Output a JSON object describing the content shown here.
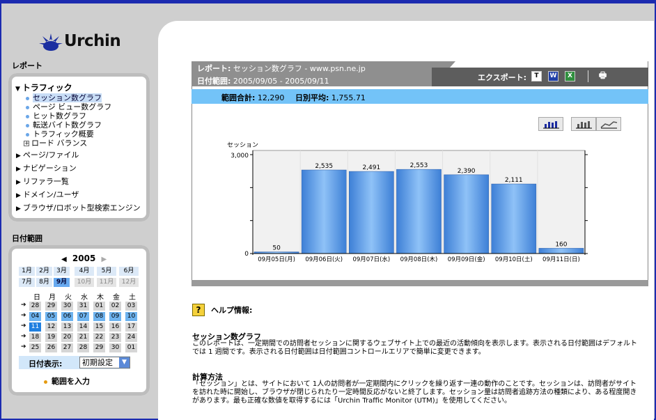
{
  "logo": {
    "text": "Urchin"
  },
  "sidebar": {
    "report_title": "レポート",
    "traffic_head": "トラフィック",
    "traffic_items": [
      "セッション数グラフ",
      "ページ ビュー数グラフ",
      "ヒット数グラフ",
      "転送バイト数グラフ",
      "トラフィック概要"
    ],
    "load_balance": "ロード バランス",
    "nav_items": [
      "ページ/ファイル",
      "ナビゲーション",
      "リファラ一覧",
      "ドメイン/ユーザ",
      "ブラウザ/ロボット型検索エンジン"
    ],
    "date_range_title": "日付範囲"
  },
  "calendar": {
    "year": "2005",
    "months": [
      "1月",
      "2月",
      "3月",
      "4月",
      "5月",
      "6月",
      "7月",
      "8月",
      "9月",
      "10月",
      "11月",
      "12月"
    ],
    "weekdays": [
      "日",
      "月",
      "火",
      "水",
      "木",
      "金",
      "土"
    ],
    "weeks": [
      [
        "28",
        "29",
        "30",
        "31",
        "01",
        "02",
        "03"
      ],
      [
        "04",
        "05",
        "06",
        "07",
        "08",
        "09",
        "10"
      ],
      [
        "11",
        "12",
        "13",
        "14",
        "15",
        "16",
        "17"
      ],
      [
        "18",
        "19",
        "20",
        "21",
        "22",
        "23",
        "24"
      ],
      [
        "25",
        "26",
        "27",
        "28",
        "29",
        "30",
        "01"
      ]
    ],
    "date_display_label": "日付表示:",
    "date_display_value": "初期設定",
    "range_entry": "範囲を入力"
  },
  "report": {
    "label": "レポート:",
    "name": "セッション数グラフ - www.psn.ne.jp",
    "date_label": "日付範囲:",
    "date_value": "2005/09/05 - 2005/09/11",
    "export_label": "エクスポート:",
    "summary_total_label": "範囲合計:",
    "summary_total_value": "12,290",
    "summary_avg_label": "日別平均:",
    "summary_avg_value": "1,755.71"
  },
  "chart_data": {
    "type": "bar",
    "ylabel": "セッション",
    "ylim": [
      0,
      3000
    ],
    "yticks": [
      "3,000",
      "0"
    ],
    "categories": [
      "09月05日(月)",
      "09月06日(火)",
      "09月07日(水)",
      "09月08日(木)",
      "09月09日(金)",
      "09月10日(土)",
      "09月11日(日)"
    ],
    "values": [
      50,
      2535,
      2491,
      2553,
      2390,
      2111,
      160
    ],
    "value_labels": [
      "50",
      "2,535",
      "2,491",
      "2,553",
      "2,390",
      "2,111",
      "160"
    ],
    "bar_color": "#5b9ee8"
  },
  "help": {
    "title": "ヘルプ情報:",
    "section1_title": "セッション数グラフ",
    "section1_text": "このレポートは、一定期間での訪問者セッションに関するウェブサイト上での最近の活動傾向を表示します。表示される日付範囲はデフォルトでは 1 週間です。表示される日付範囲は日付範囲コントロールエリアで簡単に変更できます。",
    "section2_title": "計算方法",
    "section2_text": "「セッション」とは、サイトにおいて 1人の訪問者が一定期間内にクリックを繰り返す一連の動作のことです。セッションは、訪問者がサイトを訪れた時に開始し、ブラウザが閉じられたり一定時間反応がないと終了します。セッション量は訪問者追跡方法の種類により、ある程度開きがあります。最も正確な数値を取得するには「Urchin Traffic Monitor (UTM)」を使用してください。"
  }
}
